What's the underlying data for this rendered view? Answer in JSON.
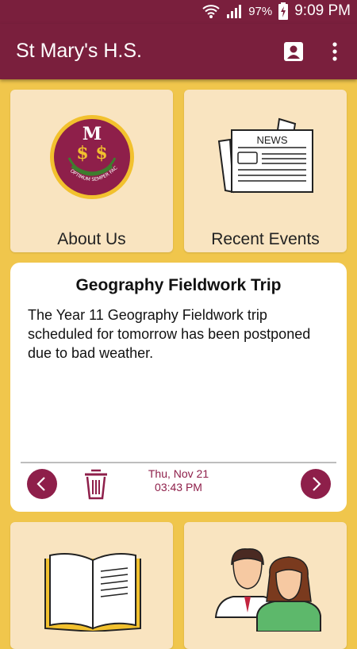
{
  "status_bar": {
    "battery": "97%",
    "time": "9:09 PM"
  },
  "app_bar": {
    "title": "St Mary's H.S."
  },
  "tiles": {
    "about": {
      "label": "About Us"
    },
    "events": {
      "label": "Recent Events",
      "newspaper_heading": "NEWS"
    }
  },
  "notice": {
    "title": "Geography Fieldwork Trip",
    "body": "The Year 11 Geography Fieldwork trip scheduled for tomorrow has been postponed due to bad weather.",
    "date": "Thu, Nov 21",
    "time": "03:43 PM"
  },
  "crest": {
    "letter": "M",
    "motto": "OPTIMUM SEMPER FACERE"
  },
  "colors": {
    "brand": "#7A1F3D",
    "accent": "#8E1F4A",
    "background": "#F0C64C",
    "tile": "#F9E4C0"
  },
  "icons": [
    "wifi-icon",
    "signal-icon",
    "battery-charging-icon",
    "contact-icon",
    "more-vert-icon",
    "chevron-left-icon",
    "trash-icon",
    "chevron-right-icon"
  ]
}
